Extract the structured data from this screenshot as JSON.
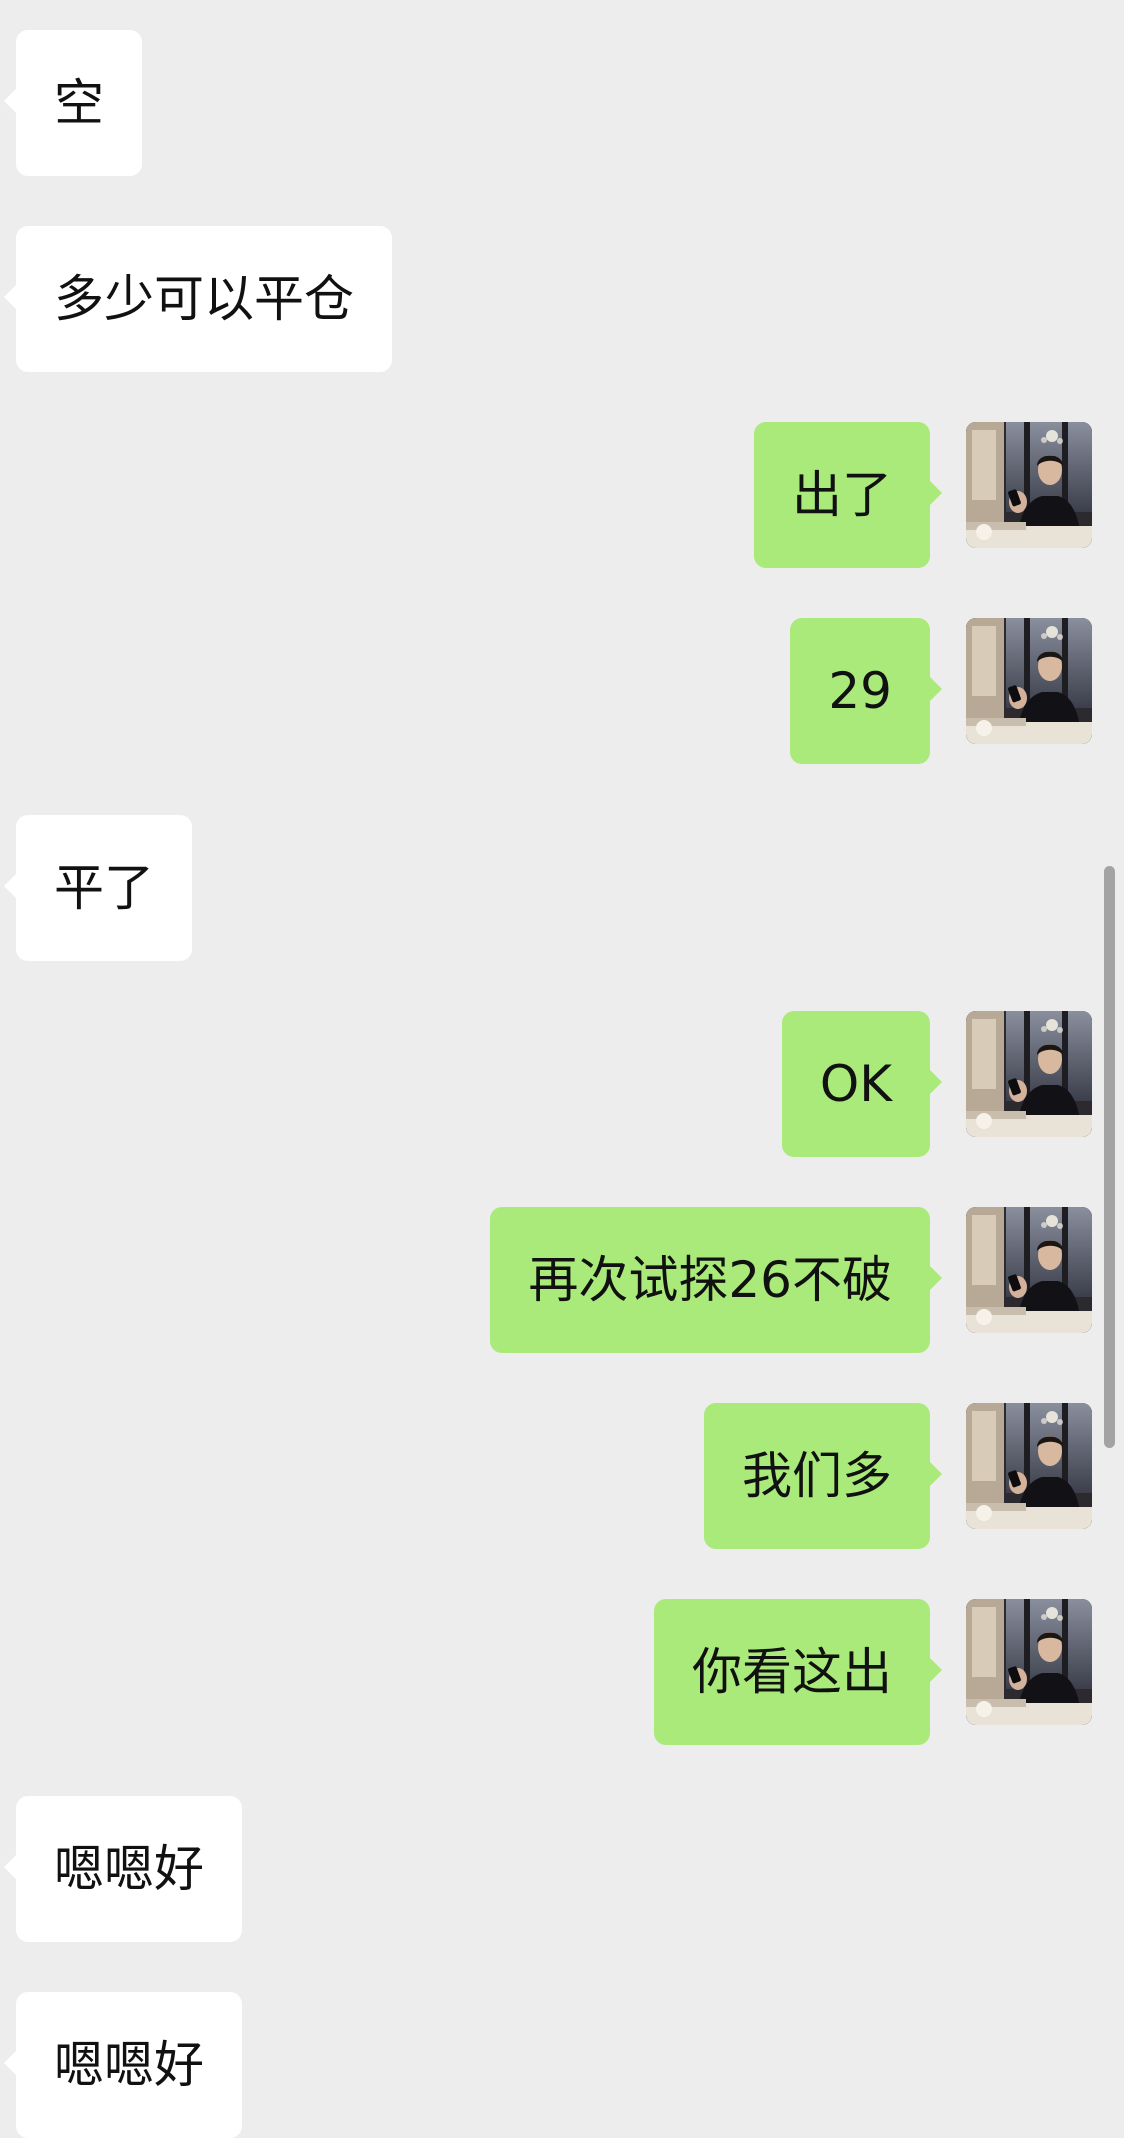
{
  "colors": {
    "background": "#ededed",
    "incoming_bubble": "#ffffff",
    "outgoing_bubble": "#a9ea7a",
    "text": "#111111",
    "scrollbar": "#a3a3a3"
  },
  "messages": [
    {
      "side": "incoming",
      "text": "空"
    },
    {
      "side": "incoming",
      "text": "多少可以平仓"
    },
    {
      "side": "outgoing",
      "text": "出了",
      "avatar": "user-avatar-photo"
    },
    {
      "side": "outgoing",
      "text": "29",
      "avatar": "user-avatar-photo"
    },
    {
      "side": "incoming",
      "text": "平了"
    },
    {
      "side": "outgoing",
      "text": "OK",
      "avatar": "user-avatar-photo"
    },
    {
      "side": "outgoing",
      "text": "再次试探26不破",
      "avatar": "user-avatar-photo"
    },
    {
      "side": "outgoing",
      "text": "我们多",
      "avatar": "user-avatar-photo"
    },
    {
      "side": "outgoing",
      "text": "你看这出",
      "avatar": "user-avatar-photo"
    },
    {
      "side": "incoming",
      "text": "嗯嗯好"
    },
    {
      "side": "incoming",
      "text": "嗯嗯好"
    }
  ]
}
